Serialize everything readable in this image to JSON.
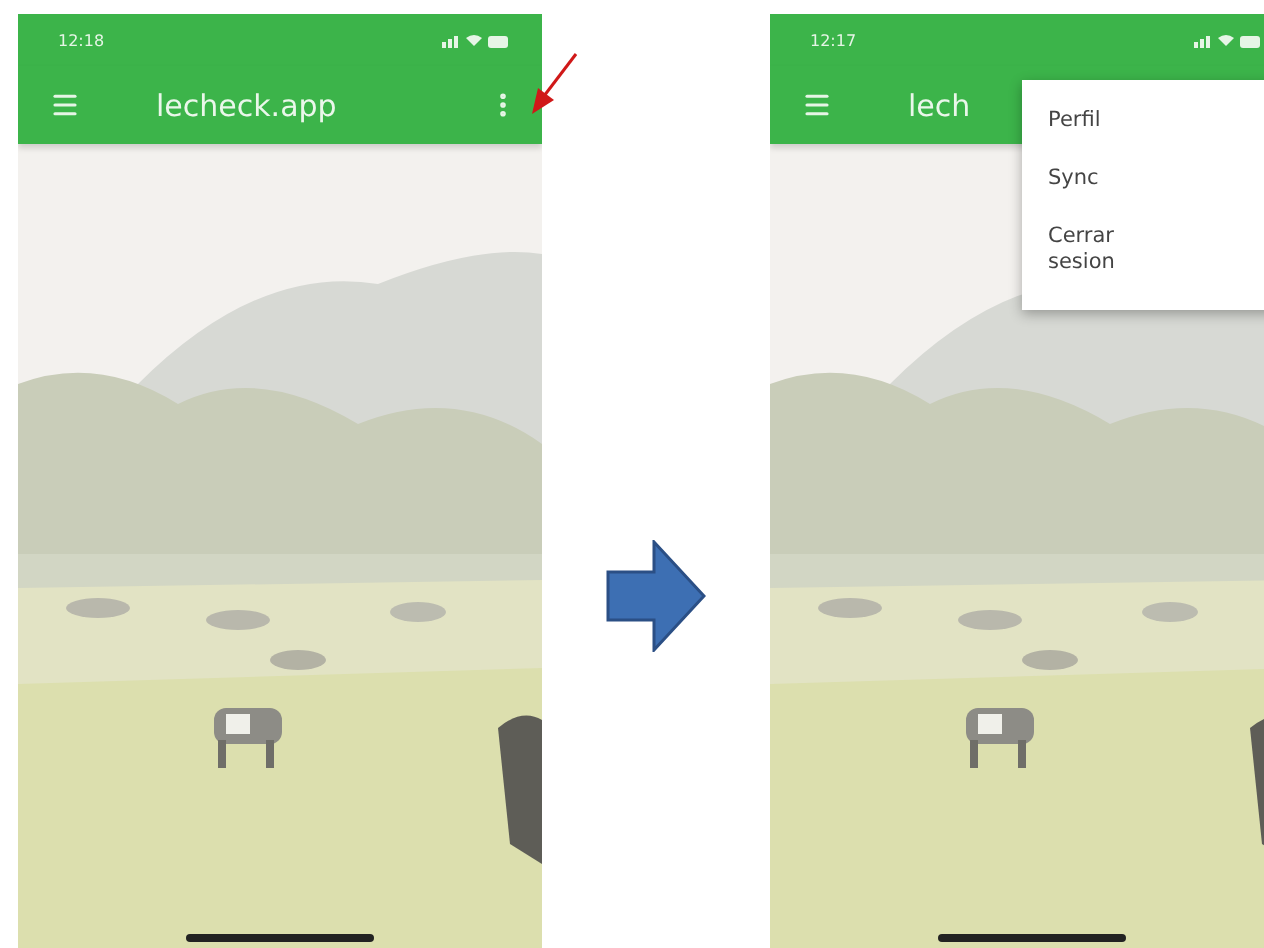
{
  "screens": [
    {
      "status_time": "12:18",
      "title": "lecheck.app"
    },
    {
      "status_time": "12:17",
      "title": "lech",
      "menu": {
        "items": [
          {
            "label": "Perfil"
          },
          {
            "label": "Sync"
          },
          {
            "label": "Cerrar sesion"
          }
        ]
      }
    }
  ]
}
